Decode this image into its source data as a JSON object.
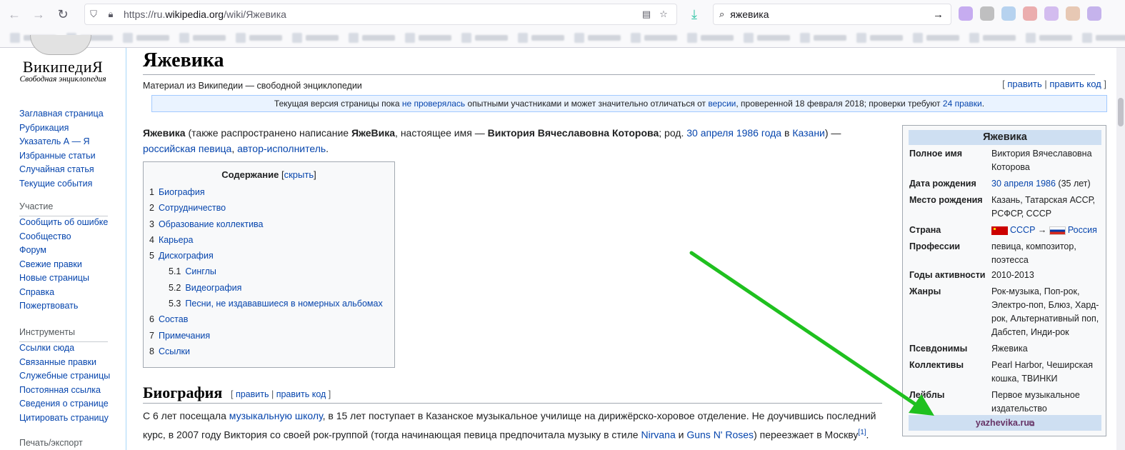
{
  "browser": {
    "url_prefix": "https://ru.",
    "url_domain": "wikipedia.org",
    "url_path": "/wiki/Яжевика",
    "search_query": "яжевика"
  },
  "sidebar": {
    "wordmark": "ВикипедиЯ",
    "tagline": "Свободная энциклопедия",
    "nav": [
      "Заглавная страница",
      "Рубрикация",
      "Указатель А — Я",
      "Избранные статьи",
      "Случайная статья",
      "Текущие события"
    ],
    "participation_heading": "Участие",
    "participation": [
      "Сообщить об ошибке",
      "Сообщество",
      "Форум",
      "Свежие правки",
      "Новые страницы",
      "Справка",
      "Пожертвовать"
    ],
    "tools_heading": "Инструменты",
    "tools": [
      "Ссылки сюда",
      "Связанные правки",
      "Служебные страницы",
      "Постоянная ссылка",
      "Сведения о странице",
      "Цитировать страницу"
    ],
    "print_heading": "Печать/экспорт"
  },
  "article": {
    "title": "Яжевика",
    "site_sub": "Материал из Википедии — свободной энциклопедии",
    "edit": "править",
    "edit_code": "править код",
    "revision": {
      "pre": "Текущая версия страницы пока ",
      "link1": "не проверялась",
      "mid1": " опытными участниками и может значительно отличаться от ",
      "link2": "версии",
      "mid2": ", проверенной 18 февраля 2018; проверки требуют ",
      "link3": "24 правки",
      "post": "."
    },
    "lead": {
      "t1": "Яжевика",
      "t2": " (также распространено написание ",
      "t3": "ЯжеВика",
      "t4": ", настоящее имя — ",
      "t5": "Виктория Вячеславовна Которова",
      "t6": "; род. ",
      "l1": "30 апреля",
      "t7": " ",
      "l2": "1986 года",
      "t8": " в ",
      "l3": "Казани",
      "t9": ") — ",
      "l4": "российская певица",
      "t10": ", ",
      "l5": "автор-исполнитель",
      "t11": "."
    },
    "toc": {
      "title": "Содержание",
      "hide": "скрыть",
      "items": [
        {
          "num": "1",
          "label": "Биография",
          "level": 1
        },
        {
          "num": "2",
          "label": "Сотрудничество",
          "level": 1
        },
        {
          "num": "3",
          "label": "Образование коллектива",
          "level": 1
        },
        {
          "num": "4",
          "label": "Карьера",
          "level": 1
        },
        {
          "num": "5",
          "label": "Дискография",
          "level": 1
        },
        {
          "num": "5.1",
          "label": "Синглы",
          "level": 2
        },
        {
          "num": "5.2",
          "label": "Видеография",
          "level": 2
        },
        {
          "num": "5.3",
          "label": "Песни, не издававшиеся в номерных альбомах",
          "level": 2
        },
        {
          "num": "6",
          "label": "Состав",
          "level": 1
        },
        {
          "num": "7",
          "label": "Примечания",
          "level": 1
        },
        {
          "num": "8",
          "label": "Ссылки",
          "level": 1
        }
      ]
    },
    "bio": {
      "heading": "Биография",
      "t1": "С 6 лет посещала ",
      "l1": "музыкальную школу",
      "t2": ", в 15 лет поступает в Казанское музыкальное училище на дирижёрско-хоровое отделение. Не доучившись последний курс, в 2007 году Виктория со своей рок-группой (тогда начинающая певица предпочитала музыку в стиле ",
      "l2": "Nirvana",
      "t3": " и ",
      "l3": "Guns N' Roses",
      "t4": ") переезжает в Москву",
      "ref": "[1]",
      "t5": "."
    }
  },
  "infobox": {
    "title": "Яжевика",
    "full_name_label": "Полное имя",
    "full_name": "Виктория Вячеславовна Которова",
    "birth_label": "Дата рождения",
    "birth_date_link": "30 апреля 1986",
    "birth_age": " (35 лет)",
    "place_label": "Место рождения",
    "place": "Казань, Татарская АССР, РСФСР, СССР",
    "country_label": "Страна",
    "country_from": "СССР",
    "country_arrow": " → ",
    "country_to": "Россия",
    "profession_label": "Профессии",
    "professions": "певица, композитор, поэтесса",
    "years_label": "Годы активности",
    "years": "2010-2013",
    "genres_label": "Жанры",
    "genres": "Рок-музыка, Поп-рок, Электро-поп, Блюз, Хард-рок, Альтернативный поп, Дабстеп, Инди-рок",
    "aliases_label": "Псевдонимы",
    "aliases": "Яжевика",
    "groups_label": "Коллективы",
    "groups": "Pearl Harbor, Чеширская кошка, ТВИНКИ",
    "labels_label": "Лейблы",
    "labels": "Первое музыкальное издательство",
    "website": "yazhevika.ru"
  },
  "colors": {
    "link": "#0645ad",
    "visited_link": "#663366",
    "arrow": "#1fc01f",
    "infobox_header": "#cedff2"
  }
}
